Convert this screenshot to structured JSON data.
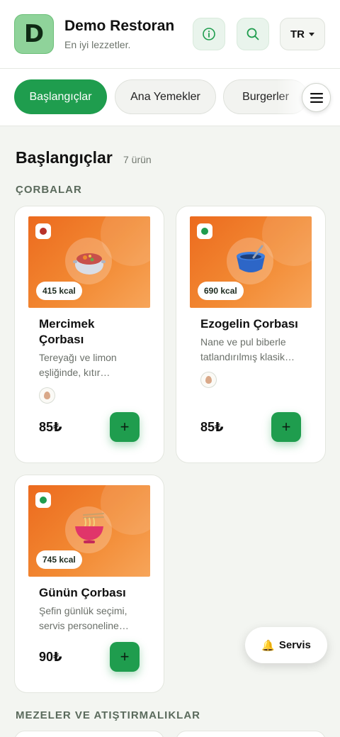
{
  "header": {
    "logo_letter": "D",
    "restaurant_name": "Demo Restoran",
    "tagline": "En iyi lezzetler.",
    "language": "TR",
    "accent": "#1f9d4e"
  },
  "tabs": [
    {
      "label": "Başlangıçlar",
      "active": true
    },
    {
      "label": "Ana Yemekler",
      "active": false
    },
    {
      "label": "Burgerler",
      "active": false
    }
  ],
  "section": {
    "title": "Başlangıçlar",
    "count": "7 ürün",
    "subcategories": [
      "ÇORBALAR",
      "MEZELER VE ATIŞTIRMALIKLAR"
    ]
  },
  "items": [
    {
      "name_line1": "Mercimek",
      "name_line2": "Çorbası",
      "desc_line1": "Tereyağı ve limon",
      "desc_line2": "eşliğinde, kıtır…",
      "kcal": "415 kcal",
      "price": "85₺",
      "diet_dot_color": "#b8322a",
      "icon": "soup-pot-icon",
      "allergen": "egg-icon"
    },
    {
      "name_line1": "Ezogelin Çorbası",
      "name_line2": "",
      "desc_line1": "Nane ve pul biberle",
      "desc_line2": "tatlandırılmış klasik…",
      "kcal": "690 kcal",
      "price": "85₺",
      "diet_dot_color": "#1f9d4e",
      "icon": "soup-bowl-icon",
      "allergen": "egg-icon"
    },
    {
      "name_line1": "Günün Çorbası",
      "name_line2": "",
      "desc_line1": "Şefin günlük seçimi,",
      "desc_line2": "servis personeline…",
      "kcal": "745 kcal",
      "price": "90₺",
      "diet_dot_color": "#1f9d4e",
      "icon": "noodle-bowl-icon",
      "allergen": ""
    }
  ],
  "service_button": {
    "label": "Servis",
    "icon": "bell-icon"
  }
}
